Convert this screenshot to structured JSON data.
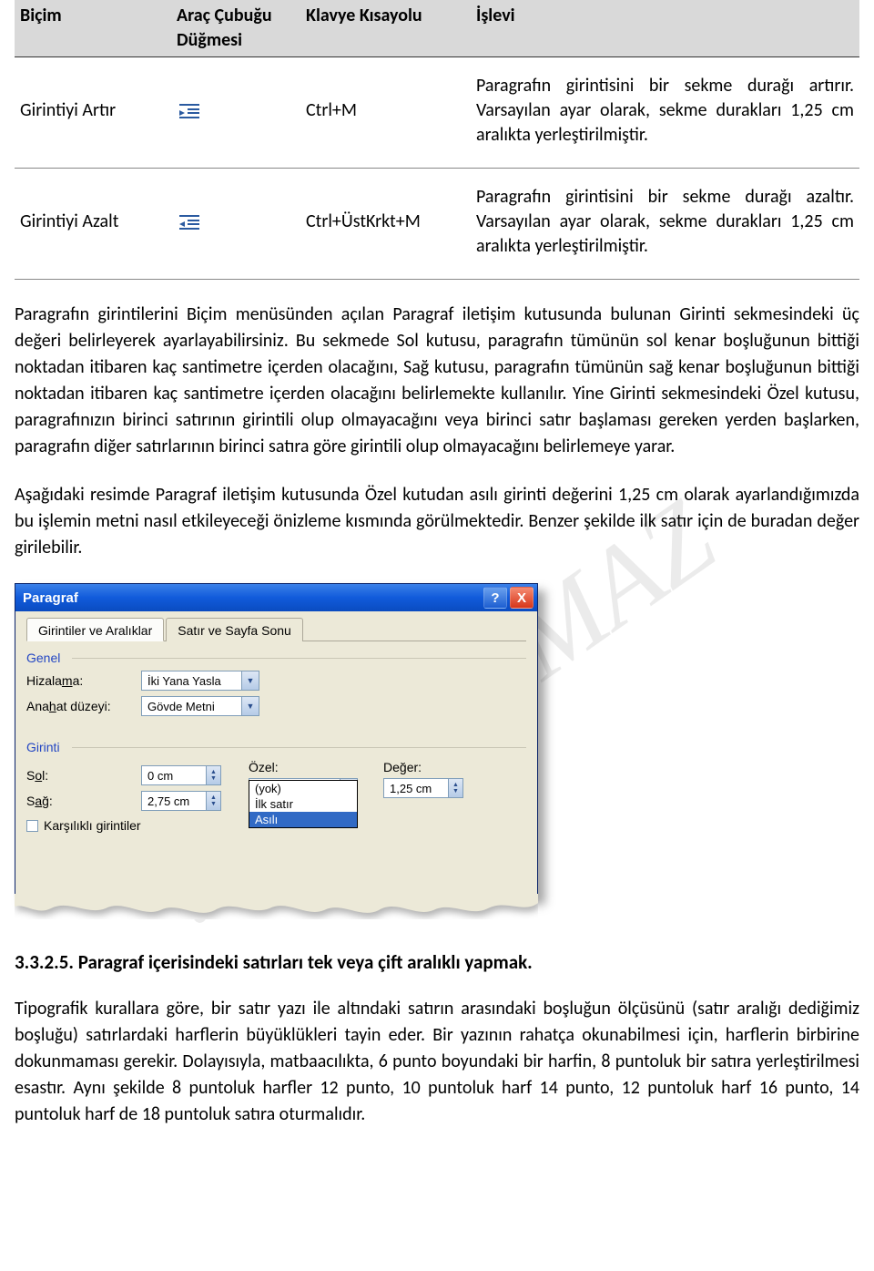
{
  "watermark": "…tafaYILMAZ",
  "table": {
    "headers": {
      "bicim": "Biçim",
      "dugme": "Araç Çubuğu Düğmesi",
      "kisayol": "Klavye Kısayolu",
      "islevi": "İşlevi"
    },
    "rows": [
      {
        "bicim": "Girintiyi Artır",
        "icon_name": "increase-indent-icon",
        "kisayol": "Ctrl+M",
        "islevi": "Paragrafın girintisini bir sekme durağı artırır. Varsayılan ayar olarak, sekme durakları 1,25 cm aralıkta yerleştirilmiştir."
      },
      {
        "bicim": "Girintiyi Azalt",
        "icon_name": "decrease-indent-icon",
        "kisayol": "Ctrl+ÜstKrkt+M",
        "islevi": "Paragrafın girintisini bir sekme durağı azaltır. Varsayılan ayar olarak, sekme durakları 1,25 cm aralıkta yerleştirilmiştir."
      }
    ]
  },
  "paragraphs": {
    "p1": "Paragrafın girintilerini Biçim menüsünden açılan Paragraf iletişim kutusunda bulunan Girinti sekmesindeki üç değeri belirleyerek ayarlayabilirsiniz. Bu sekmede Sol kutusu, paragrafın tümünün sol kenar boşluğunun bittiği noktadan itibaren kaç santimetre içerden olacağını, Sağ kutusu, paragrafın tümünün sağ kenar boşluğunun bittiği noktadan itibaren kaç santimetre içerden olacağını belirlemekte kullanılır. Yine Girinti sekmesindeki Özel kutusu, paragrafınızın birinci satırının girintili olup olmayacağını veya birinci satır başlaması gereken yerden başlarken, paragrafın diğer satırlarının birinci satıra göre girintili olup olmayacağını belirlemeye yarar.",
    "p2": "Aşağıdaki resimde Paragraf iletişim kutusunda Özel kutudan asılı girinti değerini 1,25 cm olarak ayarlandığımızda bu işlemin metni nasıl etkileyeceği önizleme kısmında görülmektedir. Benzer şekilde ilk satır için de buradan değer girilebilir.",
    "p_last": "Tipografik kurallara göre, bir satır yazı ile altındaki satırın arasındaki boşluğun ölçüsünü (satır aralığı dediğimiz boşluğu) satırlardaki harflerin büyüklükleri tayin eder. Bir yazının rahatça okunabilmesi için, harflerin birbirine dokunmaması gerekir. Dolayısıyla, matbaacılıkta, 6 punto boyundaki bir harfin, 8 puntoluk bir satıra yerleştirilmesi esastır. Aynı şekilde 8 puntoluk harfler 12 punto, 10 puntoluk harf 14 punto, 12 puntoluk harf 16 punto, 14 puntoluk harf de 18 puntoluk satıra oturmalıdır."
  },
  "dialog": {
    "title": "Paragraf",
    "tabs": {
      "active": "Girintiler ve Aralıklar",
      "inactive": "Satır ve Sayfa Sonu"
    },
    "groups": {
      "genel": {
        "title": "Genel",
        "hizalama_label": "Hizalama:",
        "hizalama_value": "İki Yana Yasla",
        "anahat_label": "Anahat düzeyi:",
        "anahat_value": "Gövde Metni"
      },
      "girinti": {
        "title": "Girinti",
        "sol_label": "Sol:",
        "sol_value": "0 cm",
        "sag_label": "Sağ:",
        "sag_value": "2,75 cm",
        "ozel_label": "Özel:",
        "ozel_value": "Asılı",
        "ozel_options": [
          "(yok)",
          "İlk satır",
          "Asılı"
        ],
        "deger_label": "Değer:",
        "deger_value": "1,25 cm",
        "karsilikli_label": "Karşılıklı girintiler"
      }
    },
    "buttons": {
      "help": "?",
      "close": "X"
    }
  },
  "section_heading": "3.3.2.5. Paragraf içerisindeki satırları tek veya çift aralıklı yapmak."
}
